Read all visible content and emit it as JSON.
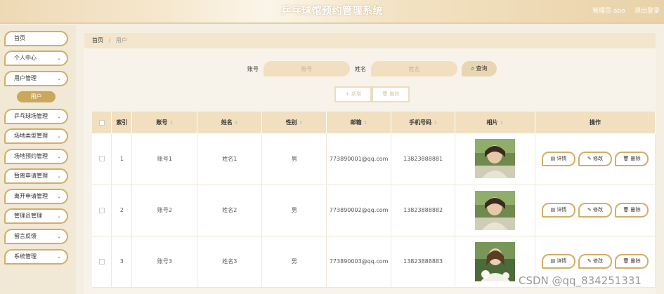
{
  "header": {
    "title": "乒乓球馆预约管理系统",
    "user": "管理员 abo",
    "logout": "退出登录"
  },
  "sidebar": {
    "items": [
      {
        "label": "首页",
        "chevron": ""
      },
      {
        "label": "个人中心",
        "chevron": "⌄"
      },
      {
        "label": "用户管理",
        "chevron": "⌄"
      },
      {
        "label": "乒乓球场管理",
        "chevron": "⌄"
      },
      {
        "label": "场地类型管理",
        "chevron": "⌄"
      },
      {
        "label": "场地预约管理",
        "chevron": "⌄"
      },
      {
        "label": "暂离申请管理",
        "chevron": "⌄"
      },
      {
        "label": "离开申请管理",
        "chevron": "⌄"
      },
      {
        "label": "管理员管理",
        "chevron": "⌄"
      },
      {
        "label": "留言反馈",
        "chevron": "⌄"
      },
      {
        "label": "系统管理",
        "chevron": "⌄"
      }
    ],
    "submenu": {
      "label": "用户"
    }
  },
  "breadcrumb": {
    "home": "首页",
    "sep": "/",
    "current": "用户"
  },
  "search": {
    "account_label": "账号",
    "account_placeholder": "账号",
    "name_label": "姓名",
    "name_placeholder": "姓名",
    "query_label": "⌕ 查询"
  },
  "actions": {
    "add": "＋ 新增",
    "delete": "🗑 删除"
  },
  "table": {
    "headers": {
      "index": "索引",
      "account": "账号",
      "name": "姓名",
      "gender": "性别",
      "email": "邮箱",
      "phone": "手机号码",
      "photo": "相片",
      "ops": "操作"
    },
    "sort_glyph": "⇕",
    "rows": [
      {
        "index": "1",
        "account": "账号1",
        "name": "姓名1",
        "gender": "男",
        "email": "773890001@qq.com",
        "phone": "13823888881"
      },
      {
        "index": "2",
        "account": "账号2",
        "name": "姓名2",
        "gender": "男",
        "email": "773890002@qq.com",
        "phone": "13823888882"
      },
      {
        "index": "3",
        "account": "账号3",
        "name": "姓名3",
        "gender": "男",
        "email": "773890003@qq.com",
        "phone": "13823888883"
      }
    ],
    "ops": {
      "detail": "▤ 详情",
      "edit": "✎ 修改",
      "delete": "🗑 删除"
    }
  },
  "watermark": "CSDN @qq_834251331",
  "colors": {
    "accent": "#d2ae66",
    "header_bg": "#eed9b4",
    "table_header": "#f1dfc0"
  }
}
